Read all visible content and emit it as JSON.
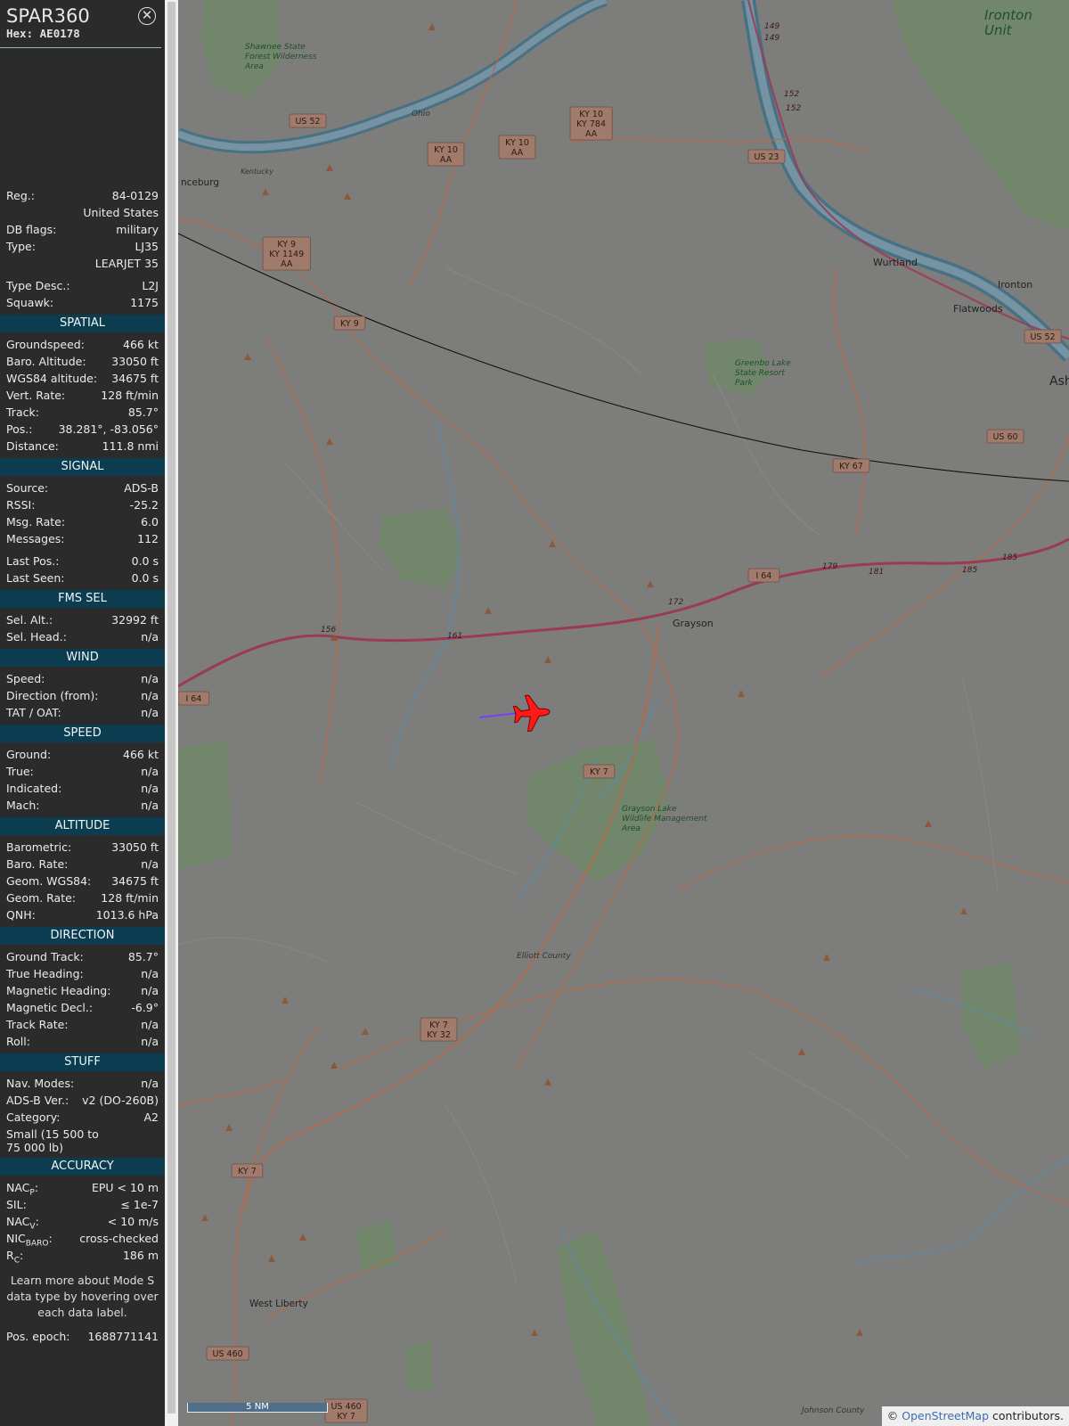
{
  "aircraft": {
    "callsign": "SPAR360",
    "hex_label": "Hex:",
    "hex": "AE0178"
  },
  "info": [
    {
      "label": "Reg.:",
      "value": "84-0129"
    },
    {
      "label": "",
      "value": "United States"
    },
    {
      "label": "DB flags:",
      "value": "military"
    },
    {
      "label": "Type:",
      "value": "LJ35"
    },
    {
      "label": "",
      "value": "LEARJET 35"
    },
    {
      "label": "Type Desc.:",
      "value": "L2J"
    },
    {
      "label": "Squawk:",
      "value": "1175"
    }
  ],
  "sections": [
    {
      "title": "SPATIAL",
      "rows": [
        {
          "label": "Groundspeed:",
          "value": "466 kt"
        },
        {
          "label": "Baro. Altitude:",
          "value": "33050 ft"
        },
        {
          "label": "WGS84 altitude:",
          "value": "34675 ft"
        },
        {
          "label": "Vert. Rate:",
          "value": "128 ft/min"
        },
        {
          "label": "Track:",
          "value": "85.7°"
        },
        {
          "label": "Pos.:",
          "value": "38.281°, -83.056°"
        },
        {
          "label": "Distance:",
          "value": "111.8 nmi"
        }
      ]
    },
    {
      "title": "SIGNAL",
      "rows": [
        {
          "label": "Source:",
          "value": "ADS-B"
        },
        {
          "label": "RSSI:",
          "value": "-25.2"
        },
        {
          "label": "Msg. Rate:",
          "value": "6.0"
        },
        {
          "label": "Messages:",
          "value": "112"
        },
        {
          "label": "Last Pos.:",
          "value": "0.0 s"
        },
        {
          "label": "Last Seen:",
          "value": "0.0 s"
        }
      ]
    },
    {
      "title": "FMS SEL",
      "rows": [
        {
          "label": "Sel. Alt.:",
          "value": "32992 ft"
        },
        {
          "label": "Sel. Head.:",
          "value": "n/a"
        }
      ]
    },
    {
      "title": "WIND",
      "rows": [
        {
          "label": "Speed:",
          "value": "n/a"
        },
        {
          "label": "Direction (from):",
          "value": "n/a"
        },
        {
          "label": "TAT / OAT:",
          "value": "n/a"
        }
      ]
    },
    {
      "title": "SPEED",
      "rows": [
        {
          "label": "Ground:",
          "value": "466 kt"
        },
        {
          "label": "True:",
          "value": "n/a"
        },
        {
          "label": "Indicated:",
          "value": "n/a"
        },
        {
          "label": "Mach:",
          "value": "n/a"
        }
      ]
    },
    {
      "title": "ALTITUDE",
      "rows": [
        {
          "label": "Barometric:",
          "value": "33050 ft"
        },
        {
          "label": "Baro. Rate:",
          "value": "n/a"
        },
        {
          "label": "Geom. WGS84:",
          "value": "34675 ft"
        },
        {
          "label": "Geom. Rate:",
          "value": "128 ft/min"
        },
        {
          "label": "QNH:",
          "value": "1013.6 hPa"
        }
      ]
    },
    {
      "title": "DIRECTION",
      "rows": [
        {
          "label": "Ground Track:",
          "value": "85.7°"
        },
        {
          "label": "True Heading:",
          "value": "n/a"
        },
        {
          "label": "Magnetic Heading:",
          "value": "n/a"
        },
        {
          "label": "Magnetic Decl.:",
          "value": "-6.9°"
        },
        {
          "label": "Track Rate:",
          "value": "n/a"
        },
        {
          "label": "Roll:",
          "value": "n/a"
        }
      ]
    },
    {
      "title": "STUFF",
      "rows": [
        {
          "label": "Nav. Modes:",
          "value": "n/a"
        },
        {
          "label": "ADS-B Ver.:",
          "value": "v2 (DO-260B)"
        },
        {
          "label": "Category:",
          "value": "A2"
        }
      ],
      "extra": "Small (15 500 to 75 000 lb)"
    },
    {
      "title": "ACCURACY",
      "rows": []
    }
  ],
  "accuracy": {
    "nacp_label": "NAC",
    "nacp_sub": "P",
    "nacp_value": "EPU < 10 m",
    "sil_label": "SIL:",
    "sil_value": "≤ 1e-7",
    "nacv_label": "NAC",
    "nacv_sub": "V",
    "nacv_value": "< 10 m/s",
    "nic_label": "NIC",
    "nic_sub": "BARO",
    "nic_value": "cross-checked",
    "rc_label": "R",
    "rc_sub": "C",
    "rc_value": "186 m"
  },
  "footer": {
    "note": "Learn more about Mode S data type by hovering over each data label.",
    "epoch_label": "Pos. epoch:",
    "epoch_value": "1688771141"
  },
  "map": {
    "scale_label": "5 NM",
    "attribution_prefix": "©",
    "attribution_link": "OpenStreetMap",
    "attribution_suffix": "contributors.",
    "places": [
      "Ironton Unit",
      "Shawnee State Forest Wilderness Area",
      "nceburg",
      "Wurtland",
      "Ironton",
      "Flatwoods",
      "Ash",
      "Greenbo Lake State Resort Park",
      "Grayson",
      "Grayson Lake Wildlife Management Area",
      "Elliott County",
      "West Liberty",
      "Johnson County",
      "Ohio",
      "Kentucky"
    ],
    "shields": [
      "US 52",
      "KY 10 AA",
      "KY 10 AA",
      "KY 10 KY 784 AA",
      "US 23",
      "KY 9 KY 1149 AA",
      "KY 9",
      "KY 67",
      "US 60",
      "I 64",
      "US 52",
      "I 64",
      "KY 7",
      "KY 7 KY 32",
      "KY 7",
      "US 460",
      "US 460 KY 7"
    ],
    "mile_markers": [
      "149",
      "149",
      "152",
      "152",
      "156",
      "161",
      "172",
      "179",
      "181",
      "185",
      "185"
    ],
    "colors": {
      "map_bg": "#7d7d7b",
      "aircraft": "#ff1a1a",
      "track": "#7a3cff",
      "sidebar_bg": "#2b2b2b",
      "section_bg": "#0c3c4f",
      "interstate": "#9b3a55",
      "secondary_road": "#b2694a"
    }
  }
}
